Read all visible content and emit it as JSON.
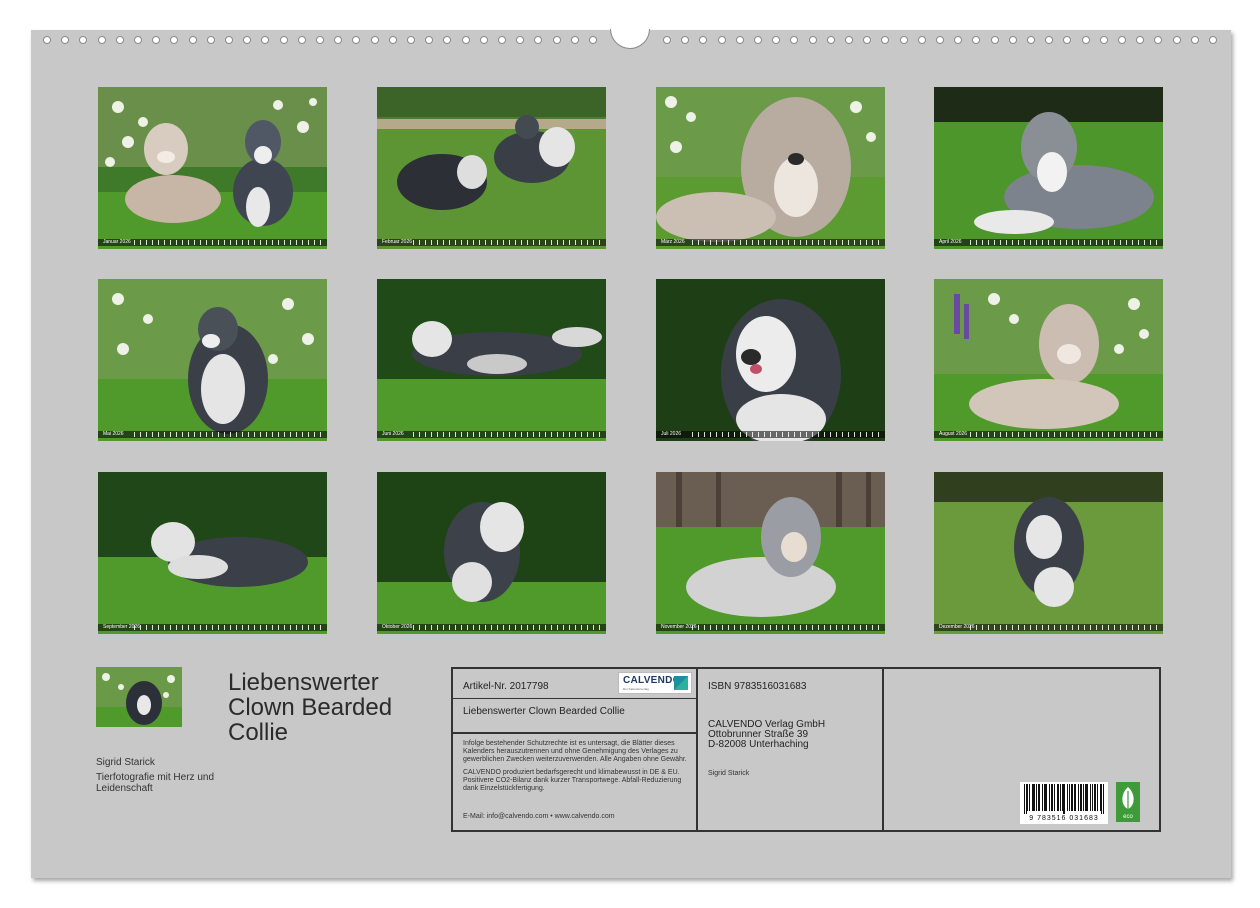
{
  "calendar": {
    "months": [
      {
        "name": "Januar 2026"
      },
      {
        "name": "Februar 2026"
      },
      {
        "name": "März 2026"
      },
      {
        "name": "April 2026"
      },
      {
        "name": "Mai 2026"
      },
      {
        "name": "Juni 2026"
      },
      {
        "name": "Juli 2026"
      },
      {
        "name": "August 2026"
      },
      {
        "name": "September 2026"
      },
      {
        "name": "Oktober 2026"
      },
      {
        "name": "November 2026"
      },
      {
        "name": "Dezember 2026"
      }
    ]
  },
  "cover": {
    "title_line1": "Liebenswerter",
    "title_line2": "Clown Bearded",
    "title_line3": "Collie",
    "author": "Sigrid Starick",
    "tagline": "Tierfotografie mit Herz und Leidenschaft"
  },
  "info": {
    "article": "Artikel-Nr. 2017798",
    "logo_text": "CALVENDO",
    "logo_sub": "Der Kalenderverlag",
    "title_small": "Liebenswerter Clown Bearded Collie",
    "legal_p1": "Infolge bestehender Schutzrechte ist es untersagt, die Blätter dieses Kalenders herauszutrennen und ohne Genehmigung des Verlages zu gewerblichen Zwecken weiterzuverwenden. Alle Angaben ohne Gewähr.",
    "legal_p2": "CALVENDO produziert bedarfsgerecht und klimabewusst in DE & EU. Positivere CO2-Bilanz dank kurzer Transportwege. Abfall-Reduzierung dank Einzelstückfertigung.",
    "email": "E-Mail: info@calvendo.com • www.calvendo.com",
    "isbn": "ISBN 9783516031683",
    "publisher_l1": "CALVENDO Verlag GmbH",
    "publisher_l2": "Ottobrunner Straße 39",
    "publisher_l3": "D-82008 Unterhaching",
    "photographer": "Sigrid Starick",
    "barcode_number": "9 783516 031683",
    "eco_label": "eco"
  },
  "colors": {
    "sheet": "#c8c8c8",
    "grass": "#4f9a2a",
    "foliage": "#2f5a1e",
    "eco_green": "#3f9a3a",
    "calvendo_blue": "#1e3a66"
  },
  "icons": [
    "calvendo-logo-icon",
    "barcode-icon",
    "eco-leaf-icon"
  ]
}
